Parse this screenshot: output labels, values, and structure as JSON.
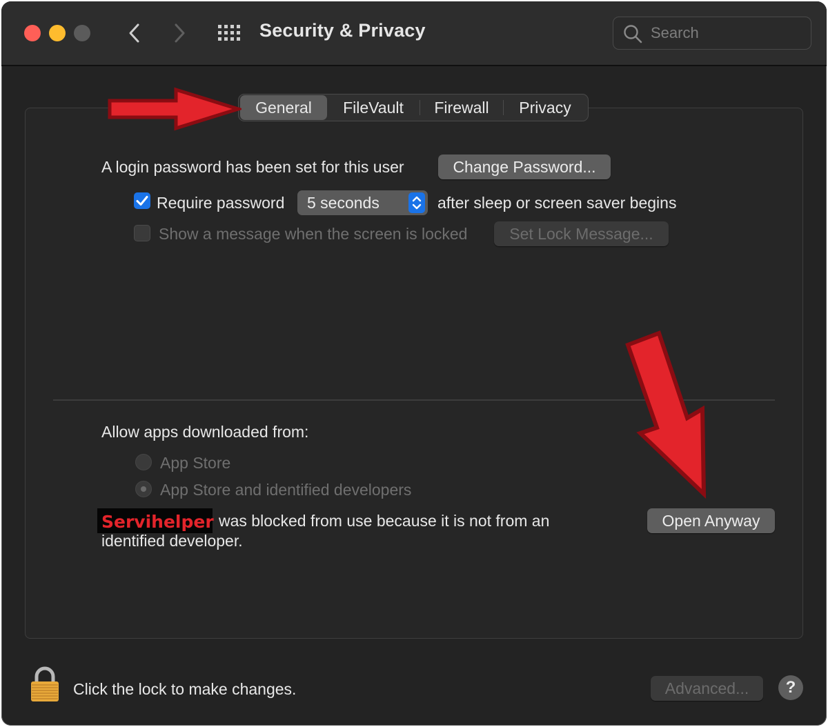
{
  "window": {
    "title": "Security & Privacy"
  },
  "toolbar": {
    "back_icon": "chevron-left-icon",
    "forward_icon": "chevron-right-icon",
    "grid_icon": "show-all-grid-icon"
  },
  "search": {
    "placeholder": "Search",
    "icon": "search-icon"
  },
  "tabs": [
    {
      "label": "General",
      "selected": true
    },
    {
      "label": "FileVault",
      "selected": false
    },
    {
      "label": "Firewall",
      "selected": false
    },
    {
      "label": "Privacy",
      "selected": false
    }
  ],
  "general": {
    "login_text": "A login password has been set for this user",
    "change_password_label": "Change Password...",
    "require_password": {
      "label": "Require password",
      "checked": true,
      "delay_value": "5 seconds",
      "suffix": "after sleep or screen saver begins"
    },
    "lock_message": {
      "label": "Show a message when the screen is locked",
      "checked": false,
      "enabled": false,
      "button_label": "Set Lock Message..."
    }
  },
  "downloads": {
    "heading": "Allow apps downloaded from:",
    "options": [
      {
        "label": "App Store",
        "selected": false,
        "enabled": false
      },
      {
        "label": "App Store and identified developers",
        "selected": true,
        "enabled": false
      }
    ],
    "blocked_app_name": "Servihelper",
    "blocked_line1": "was blocked from use because it is not from an",
    "blocked_line2": "identified developer.",
    "open_anyway_label": "Open Anyway"
  },
  "footer": {
    "lock_text": "Click the lock to make changes.",
    "lock_icon": "padlock-icon",
    "advanced_label": "Advanced...",
    "help_label": "?"
  },
  "colors": {
    "window_bg": "#232323",
    "accent_blue": "#1a73e8",
    "annotation_red": "#e3242b",
    "close": "#ff5f57",
    "minimize": "#febc2e"
  }
}
